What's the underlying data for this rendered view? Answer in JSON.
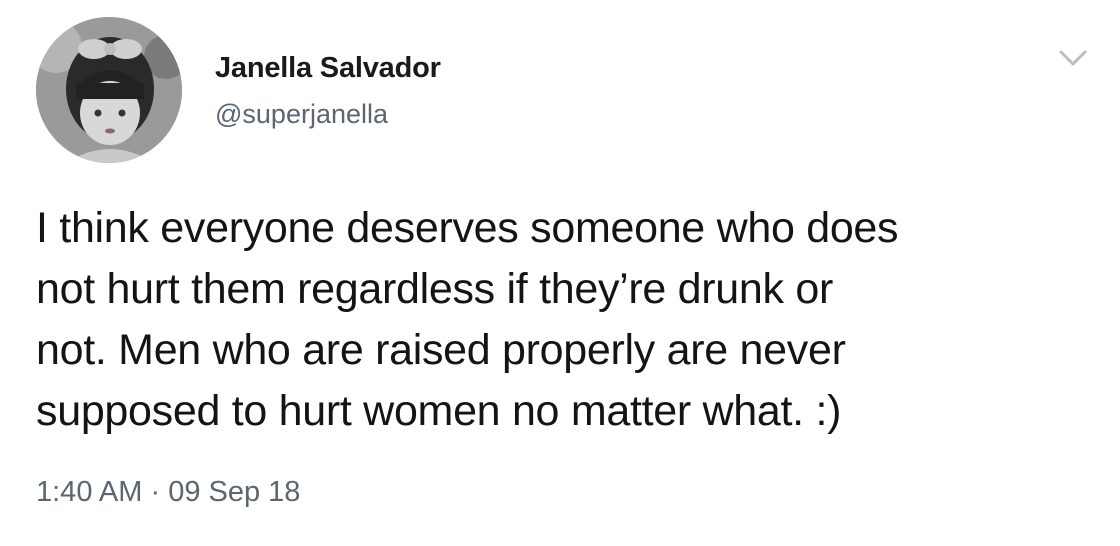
{
  "author": {
    "name": "Janella Salvador",
    "handle": "@superjanella"
  },
  "tweet": {
    "lines": [
      "I think everyone deserves someone who does",
      "not hurt them regardless if they’re drunk or",
      "not. Men who are raised properly are never",
      "supposed to hurt women no matter what. :)"
    ]
  },
  "meta": {
    "time": "1:40 AM",
    "separator": "·",
    "date": "09 Sep 18"
  },
  "icons": {
    "menu": "chevron-down-icon",
    "avatar": "profile-photo"
  },
  "colors": {
    "name": "#1a1a1a",
    "handle": "#5b6670",
    "body": "#141414",
    "chevron": "#b8bec4"
  }
}
